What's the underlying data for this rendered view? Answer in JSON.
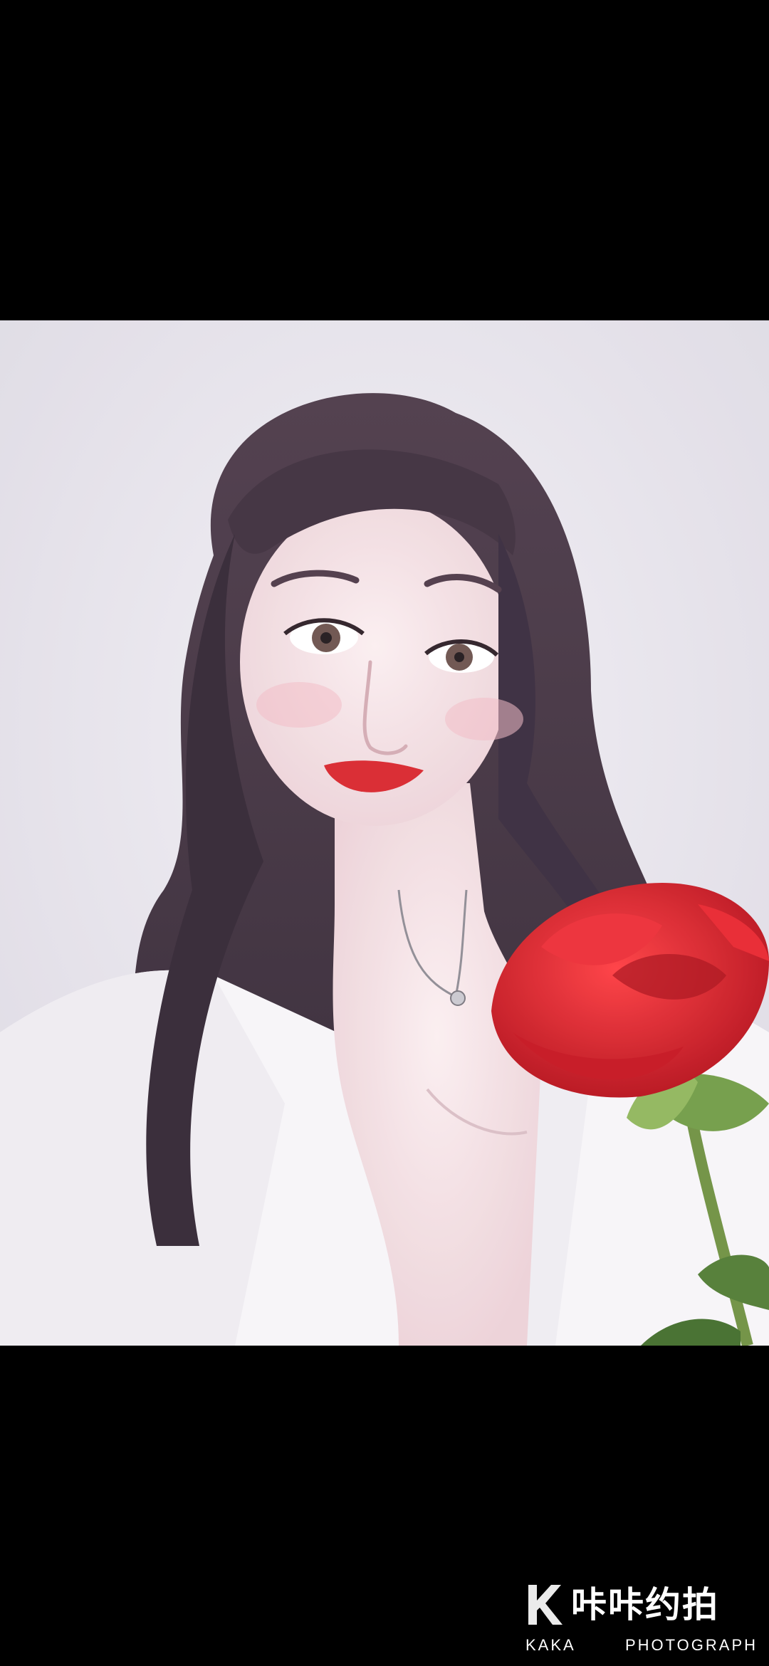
{
  "viewer": {
    "background_color": "#000000"
  },
  "photo": {
    "subject": "portrait-with-red-rose",
    "accent_colors": {
      "backdrop": "#e9e6ee",
      "hair": "#3a2a38",
      "shirt": "#f7f5f8",
      "lips": "#d8232a",
      "rose": "#d9141f",
      "leaf": "#5a8a3a"
    }
  },
  "watermark": {
    "logo_icon": "k-logo-icon",
    "brand": "咔咔约拍",
    "sub_left": "KAKA",
    "sub_right": "PHOTOGRAPH"
  }
}
